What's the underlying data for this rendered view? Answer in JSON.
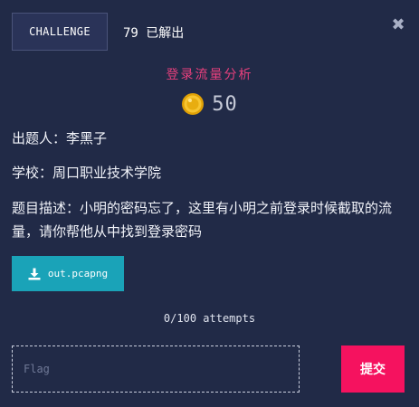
{
  "header": {
    "tab_label": "CHALLENGE",
    "solves_text": "79 已解出",
    "close_icon": "close-icon"
  },
  "challenge": {
    "title": "登录流量分析",
    "points": "50",
    "author_line": "出题人：李黑子",
    "school_line": "学校：周口职业技术学院",
    "description_line": "题目描述：小明的密码忘了，这里有小明之前登录时候截取的流量，请你帮他从中找到登录密码"
  },
  "download": {
    "filename": "out.pcapng",
    "icon": "download-icon"
  },
  "attempts_text": "0/100 attempts",
  "flag_form": {
    "placeholder": "Flag",
    "value": "",
    "submit_label": "提交"
  },
  "colors": {
    "background": "#212a47",
    "title": "#e8407d",
    "download_button": "#1aa3b8",
    "submit_button": "#f5125f",
    "coin": "#f2b705"
  }
}
